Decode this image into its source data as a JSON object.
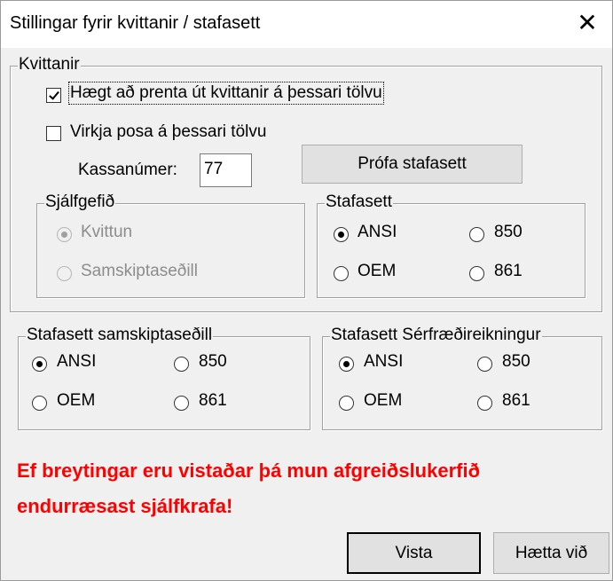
{
  "window": {
    "title": "Stillingar fyrir kvittanir / stafasett",
    "close_symbol": "✕"
  },
  "kvittanir": {
    "legend": "Kvittanir",
    "print_checkbox": {
      "label": "Hægt að prenta út kvittanir á þessari tölvu",
      "checked": true
    },
    "pos_checkbox": {
      "label": "Virkja posa á þessari tölvu",
      "checked": false
    },
    "register_label": "Kassanúmer:",
    "register_value": "77",
    "test_button": "Prófa stafasett",
    "default": {
      "legend": "Sjálfgefið",
      "options": [
        "Kvittun",
        "Samskiptaseðill"
      ],
      "selected": "Kvittun",
      "disabled": true
    },
    "charset": {
      "legend": "Stafasett",
      "options": [
        "ANSI",
        "850",
        "OEM",
        "861"
      ],
      "selected": "ANSI"
    }
  },
  "samskiptaseðill_charset": {
    "legend": "Stafasett samskiptaseðill",
    "options": [
      "ANSI",
      "850",
      "OEM",
      "861"
    ],
    "selected": "ANSI"
  },
  "serfraedi_charset": {
    "legend": "Stafasett Sérfræðireikningur",
    "options": [
      "ANSI",
      "850",
      "OEM",
      "861"
    ],
    "selected": "ANSI"
  },
  "warning": "Ef breytingar eru vistaðar þá mun afgreiðslukerfið endurræsast sjálfkrafa!",
  "warning_color": "#ff0000",
  "buttons": {
    "save": "Vista",
    "cancel": "Hætta við"
  }
}
